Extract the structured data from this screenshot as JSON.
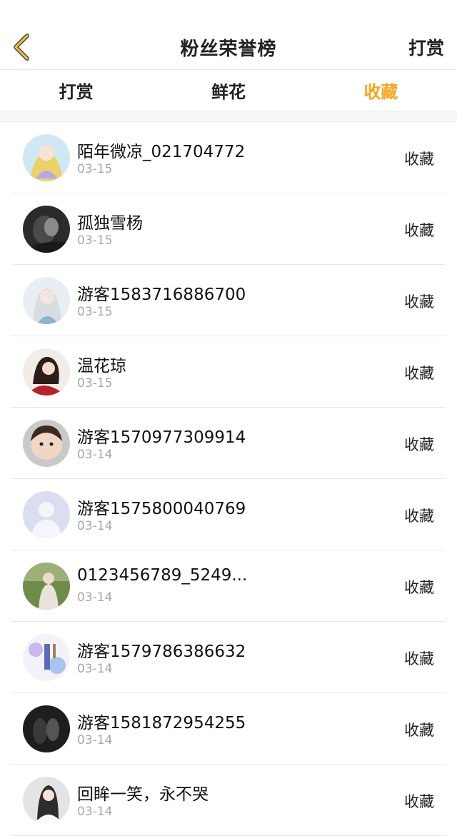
{
  "header": {
    "title": "粉丝荣誉榜",
    "right_label": "打赏",
    "accent": "#f5a623"
  },
  "tabs": [
    {
      "label": "打赏",
      "active": false
    },
    {
      "label": "鲜花",
      "active": false
    },
    {
      "label": "收藏",
      "active": true
    }
  ],
  "rows": [
    {
      "name": "陌年微凉_021704772",
      "date": "03-15",
      "action": "收藏"
    },
    {
      "name": "孤独雪杨",
      "date": "03-15",
      "action": "收藏"
    },
    {
      "name": "游客1583716886700",
      "date": "03-15",
      "action": "收藏"
    },
    {
      "name": "温花琼",
      "date": "03-15",
      "action": "收藏"
    },
    {
      "name": "游客1570977309914",
      "date": "03-14",
      "action": "收藏"
    },
    {
      "name": "游客1575800040769",
      "date": "03-14",
      "action": "收藏"
    },
    {
      "name": "0123456789_5249...",
      "date": "03-14",
      "action": "收藏"
    },
    {
      "name": "游客1579786386632",
      "date": "03-14",
      "action": "收藏"
    },
    {
      "name": "游客1581872954255",
      "date": "03-14",
      "action": "收藏"
    },
    {
      "name": "回眸一笑，永不哭",
      "date": "03-14",
      "action": "收藏"
    }
  ]
}
